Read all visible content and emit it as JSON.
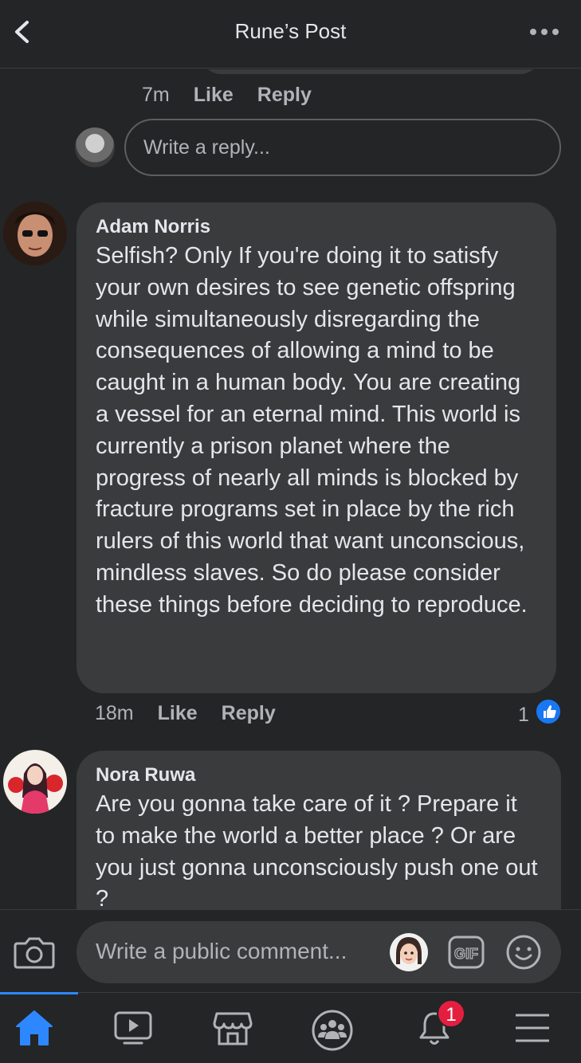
{
  "header": {
    "title": "Rune’s Post"
  },
  "previous_comment": {
    "time": "7m",
    "like_label": "Like",
    "reply_label": "Reply"
  },
  "reply_box": {
    "placeholder": "Write a reply..."
  },
  "comments": [
    {
      "author": "Adam Norris",
      "text": "Selfish? Only If you're doing it to satisfy your own desires to see genetic offspring while simultaneously disregarding the consequences of allowing a mind to be caught in a human body. You are creating a vessel for an eternal mind. This world is currently a prison planet where the progress of nearly all minds is blocked by fracture programs set in place by the rich rulers of this world that want unconscious, mindless slaves. So do please consider these things before deciding to reproduce.",
      "time": "18m",
      "like_label": "Like",
      "reply_label": "Reply",
      "reactions": "1"
    },
    {
      "author": "Nora Ruwa",
      "text": "Are you gonna take care of it ? Prepare it to make the world a better place ? Or are you just gonna unconsciously push one out ?"
    }
  ],
  "composer": {
    "placeholder": "Write a public comment...",
    "gif_label": "GIF"
  },
  "nav": {
    "notifications_badge": "1",
    "active": "home"
  },
  "colors": {
    "background": "#242526",
    "bubble": "#3a3b3c",
    "accent": "#2d88ff",
    "badge": "#e41e3f"
  }
}
